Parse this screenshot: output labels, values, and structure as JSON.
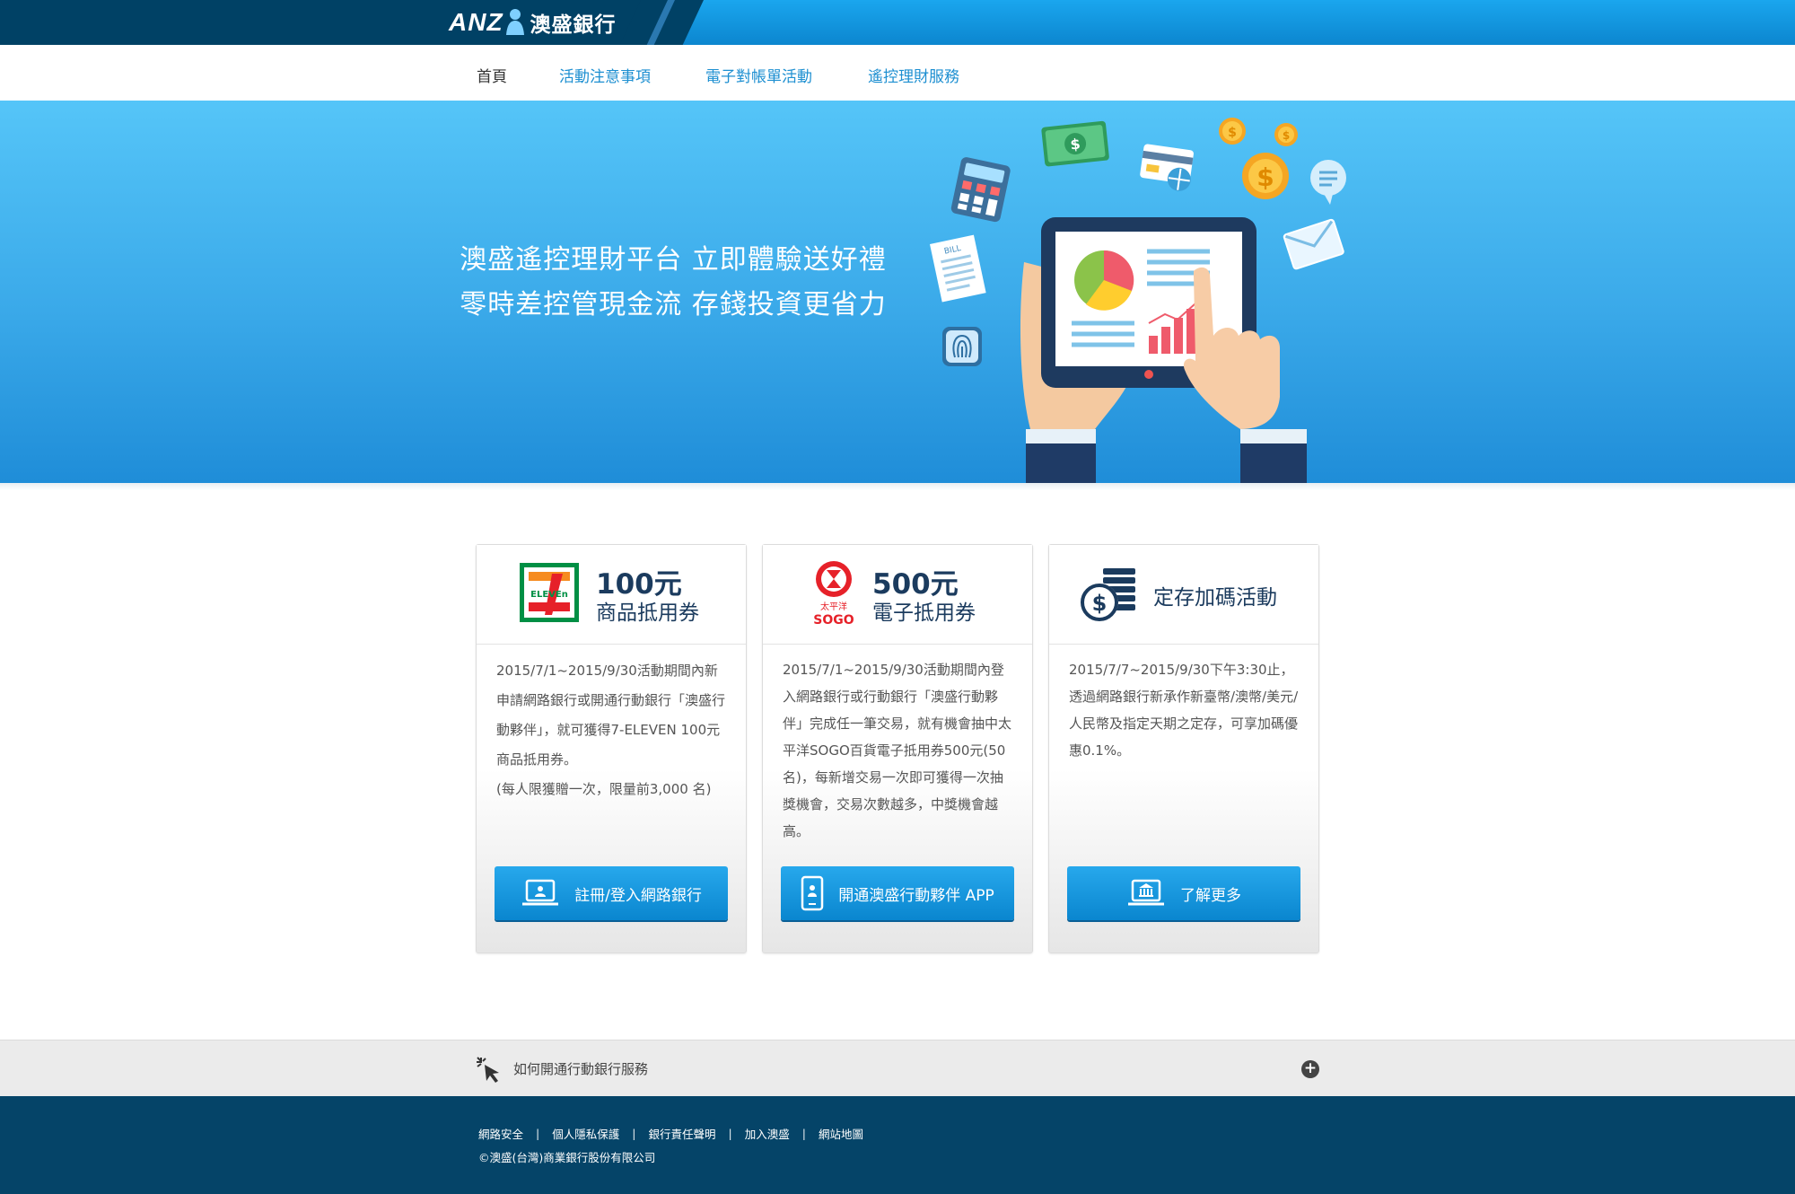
{
  "brand": {
    "logo_latin": "ANZ",
    "logo_cn": "澳盛銀行"
  },
  "nav": {
    "items": [
      "首頁",
      "活動注意事項",
      "電子對帳單活動",
      "遙控理財服務"
    ]
  },
  "hero": {
    "line1": "澳盛遙控理財平台  立即體驗送好禮",
    "line2": "零時差控管現金流  存錢投資更省力",
    "bill_label": "BILL"
  },
  "cards": [
    {
      "amount": "100元",
      "subtitle": "商品抵用券",
      "logo_text": "ELEVEn",
      "body": [
        "2015/7/1~2015/9/30活動期間內新申請網路銀行或開通行動銀行「澳盛行動夥伴」，就可獲得7-ELEVEN 100元商品抵用券。",
        "(每人限獲贈一次，限量前3,000 名)"
      ],
      "button": "註冊/登入網路銀行"
    },
    {
      "amount": "500元",
      "subtitle": "電子抵用券",
      "logo_text_top": "太平洋",
      "logo_text_bottom": "SOGO",
      "body": [
        "2015/7/1~2015/9/30活動期間內登入網路銀行或行動銀行「澳盛行動夥伴」完成任一筆交易，就有機會抽中太平洋SOGO百貨電子抵用券500元(50名)，每新增交易一次即可獲得一次抽獎機會，交易次數越多，中獎機會越高。"
      ],
      "button": "開通澳盛行動夥伴 APP"
    },
    {
      "title": "定存加碼活動",
      "body": [
        "2015/7/7~2015/9/30下午3:30止，透過網路銀行新承作新臺幣/澳幣/美元/人民幣及指定天期之定存，可享加碼優惠0.1%。"
      ],
      "button": "了解更多"
    }
  ],
  "faq": {
    "label": "如何開通行動銀行服務",
    "toggle": "+"
  },
  "footer": {
    "links": [
      "網路安全",
      "個人隱私保護",
      "銀行責任聲明",
      "加入澳盛",
      "網站地圖"
    ],
    "separator": "|",
    "copyright": "©澳盛(台灣)商業銀行股份有限公司"
  },
  "colors": {
    "brand_navy": "#004165",
    "accent_blue": "#0a86cf",
    "nav_link": "#1d8fd1",
    "footer_bg": "#054468"
  }
}
